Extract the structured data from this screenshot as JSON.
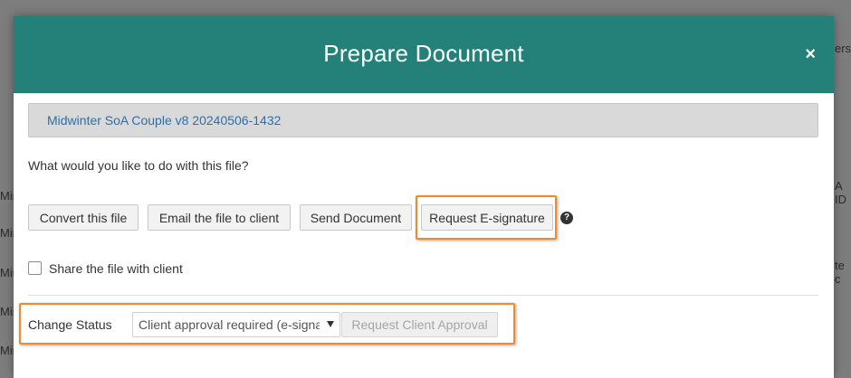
{
  "background": {
    "fragments": [
      "Min",
      "Min",
      "Min",
      "Min",
      "Min",
      "ers",
      "A ID",
      "te c"
    ]
  },
  "modal": {
    "title": "Prepare Document",
    "close_label": "×",
    "header_color": "#23817a",
    "filename": "Midwinter SoA Couple v8 20240506-1432",
    "question": "What would you like to do with this file?",
    "actions": {
      "convert": "Convert this file",
      "email": "Email the file to client",
      "send": "Send Document",
      "esign": "Request E-signature",
      "help": "?"
    },
    "share_label": "Share the file with client",
    "share_checked": false,
    "status": {
      "label": "Change Status",
      "selected": "Client approval required (e-signat",
      "approve_label": "Request Client Approval"
    },
    "highlight_color": "#ef8a2e"
  }
}
